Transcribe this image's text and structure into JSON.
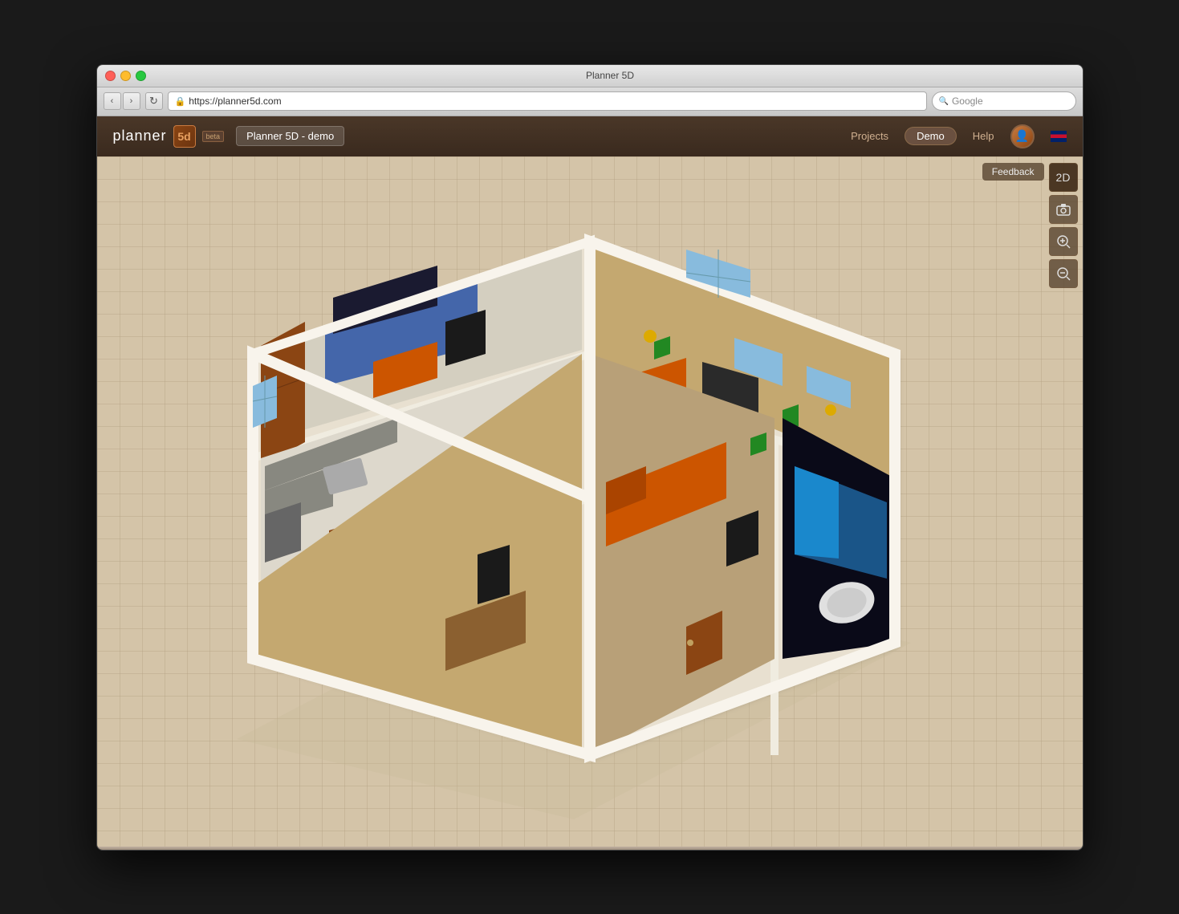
{
  "window": {
    "title": "Planner 5D",
    "url": "https://planner5d.com",
    "search_placeholder": "Google"
  },
  "header": {
    "logo_text": "planner",
    "logo_num": "5d",
    "beta_label": "beta",
    "project_name": "Planner 5D - demo",
    "nav": {
      "projects": "Projects",
      "demo": "Demo",
      "help": "Help"
    }
  },
  "toolbar": {
    "feedback": "Feedback",
    "view_2d": "2D",
    "camera_icon": "📷",
    "zoom_in_icon": "🔍",
    "zoom_out_icon": "🔍"
  },
  "traffic_lights": {
    "close": "close",
    "minimize": "minimize",
    "maximize": "maximize"
  }
}
